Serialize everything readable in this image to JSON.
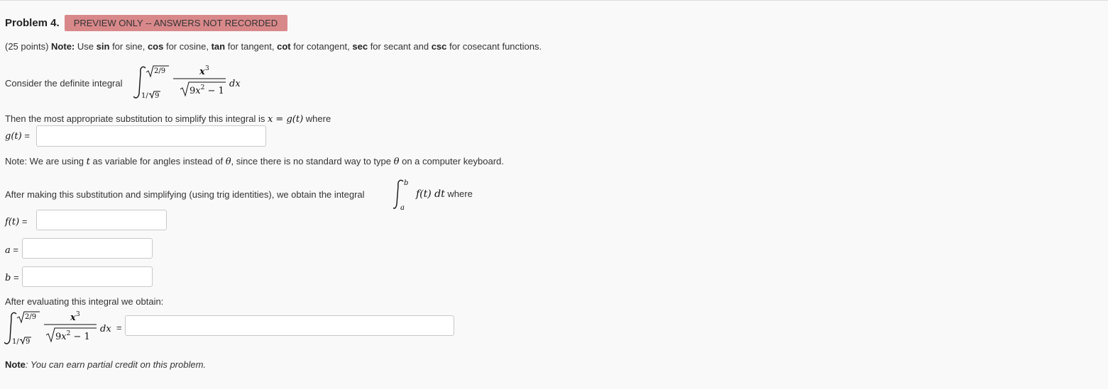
{
  "problem": {
    "title": "Problem 4.",
    "badge": "PREVIEW ONLY -- ANSWERS NOT RECORDED"
  },
  "intro": {
    "points": "(25 points)",
    "note_label": "Note:",
    "use": "Use",
    "sin": "sin",
    "for_sine": "for sine,",
    "cos": "cos",
    "for_cosine": "for cosine,",
    "tan": "tan",
    "for_tangent": "for tangent,",
    "cot": "cot",
    "for_cotangent": "for cotangent,",
    "sec": "sec",
    "for_secant": "for secant and",
    "csc": "csc",
    "for_cosecant": "for cosecant functions."
  },
  "consider": {
    "text": "Consider the definite integral",
    "upper_limit": "√2/9",
    "lower_limit": "1/√9",
    "numerator": "x³",
    "denominator": "√9x² − 1",
    "dx": "dx"
  },
  "substitution": {
    "text": "Then the most appropriate substitution to simplify this integral is",
    "equation": "x = g(t)",
    "where": "where"
  },
  "g_field": {
    "label": "g(t)",
    "eq": "=",
    "value": ""
  },
  "angle_note": {
    "part1": "Note: We are using",
    "t": "t",
    "part2": "as variable for angles instead of",
    "theta": "θ",
    "part3": ", since there is no standard way to type",
    "theta2": "θ",
    "part4": "on a computer keyboard."
  },
  "after_sub": {
    "text": "After making this substitution and simplifying (using trig identities), we obtain the integral",
    "upper": "b",
    "lower": "a",
    "integrand": "f(t) dt",
    "where": "where"
  },
  "f_field": {
    "label": "f(t)",
    "eq": "=",
    "value": ""
  },
  "a_field": {
    "label": "a",
    "eq": "=",
    "value": ""
  },
  "b_field": {
    "label": "b",
    "eq": "=",
    "value": ""
  },
  "evaluate": {
    "text": "After evaluating this integral we obtain:",
    "upper_limit": "√2/9",
    "lower_limit": "1/√9",
    "numerator": "x³",
    "denominator": "√9x² − 1",
    "dx": "dx",
    "eq": "=",
    "value": ""
  },
  "footer": {
    "note_label": "Note",
    "note_text": ": You can earn partial credit on this problem."
  }
}
